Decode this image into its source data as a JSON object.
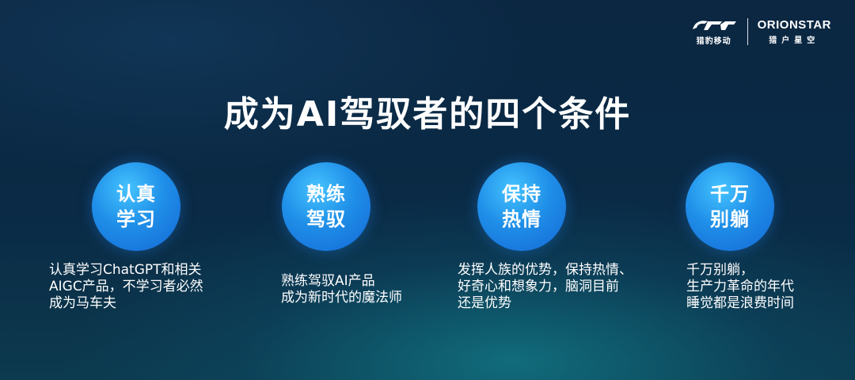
{
  "logo": {
    "brand1_sub": "猎豹移动",
    "brand2_name": "ORIONSTAR",
    "brand2_sub": "猎户星空"
  },
  "title": "成为AI驾驭者的四个条件",
  "conditions": [
    {
      "circle_lines": [
        "认真",
        "学习"
      ],
      "desc_lines": [
        "认真学习ChatGPT和相关",
        "AIGC产品，不学习者必然",
        "成为马车夫"
      ]
    },
    {
      "circle_lines": [
        "熟练",
        "驾驭"
      ],
      "desc_lines": [
        "熟练驾驭AI产品",
        "成为新时代的魔法师"
      ]
    },
    {
      "circle_lines": [
        "保持",
        "热情"
      ],
      "desc_lines": [
        "发挥人族的优势，保持热情、",
        "好奇心和想象力，脑洞目前",
        "还是优势"
      ]
    },
    {
      "circle_lines": [
        "千万",
        "别躺"
      ],
      "desc_lines": [
        "千万别躺，",
        "生产力革命的年代",
        "睡觉都是浪费时间"
      ]
    }
  ]
}
